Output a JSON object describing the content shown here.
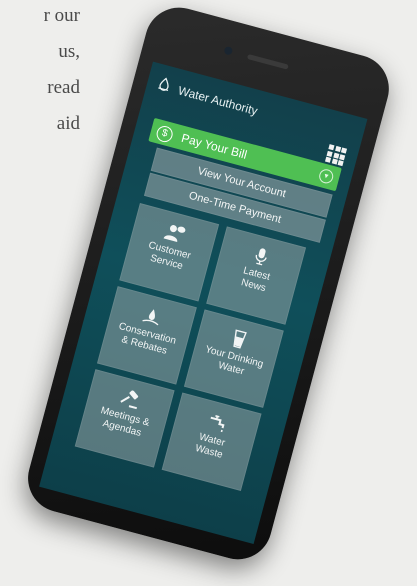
{
  "background_text": {
    "lines": [
      "r our",
      "us,",
      "read",
      "aid"
    ]
  },
  "app": {
    "title": "Water Authority",
    "logo_icon": "water-drop-icon",
    "menu_icon": "grid-menu-icon",
    "accent_green": "#4fbf53",
    "screen_bg": "#0f4f5a"
  },
  "buttons": {
    "pay_your_bill": "Pay Your Bill",
    "pay_icon": "dollar-circle-icon",
    "dropdown_icon": "chevron-down-icon",
    "view_account": "View Your Account",
    "one_time_payment": "One-Time Payment"
  },
  "tiles": [
    {
      "line1": "Customer",
      "line2": "Service",
      "icon": "customer-service-icon"
    },
    {
      "line1": "Latest",
      "line2": "News",
      "icon": "microphone-icon"
    },
    {
      "line1": "Conservation",
      "line2": "& Rebates",
      "icon": "water-splash-icon"
    },
    {
      "line1": "Your Drinking",
      "line2": "Water",
      "icon": "glass-icon"
    },
    {
      "line1": "Meetings &",
      "line2": "Agendas",
      "icon": "gavel-icon"
    },
    {
      "line1": "Water",
      "line2": "Waste",
      "icon": "faucet-icon"
    }
  ]
}
